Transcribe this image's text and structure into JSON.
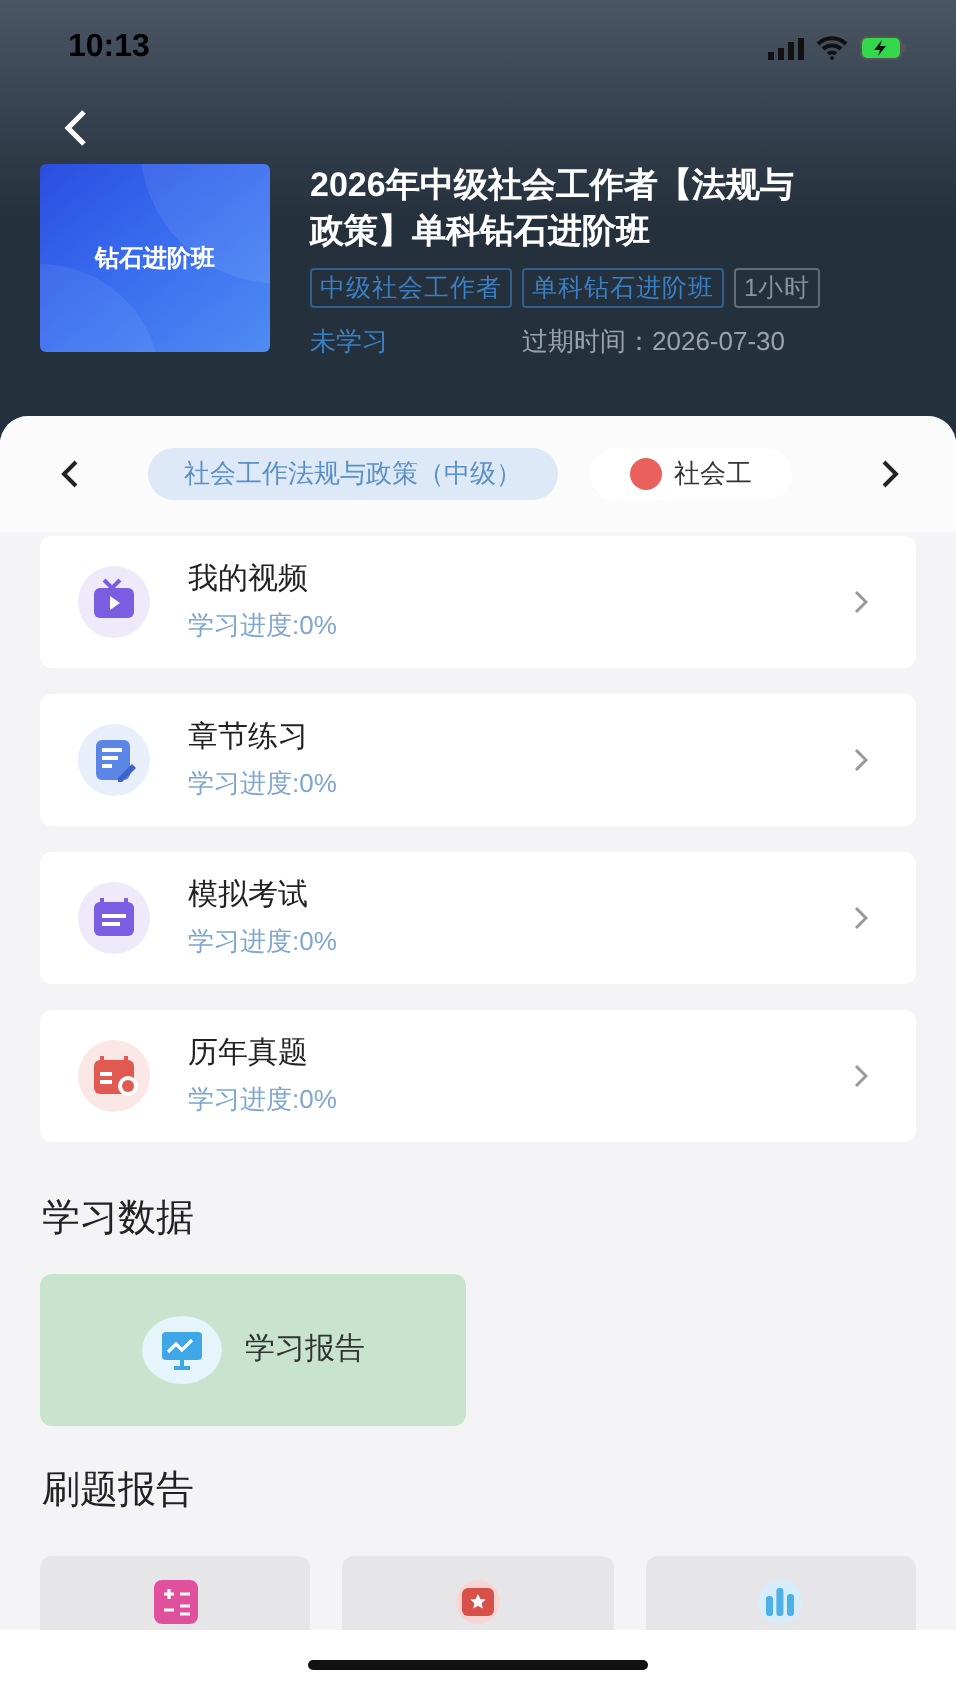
{
  "status_bar": {
    "time": "10:13"
  },
  "course": {
    "cover_label": "钻石进阶班",
    "title": "2026年中级社会工作者【法规与政策】单科钻石进阶班",
    "tags": [
      {
        "label": "中级社会工作者",
        "color": "#3b7fc4"
      },
      {
        "label": "单科钻石进阶班",
        "color": "#3b7fc4"
      },
      {
        "label": "1小时",
        "color": "#8a94a0"
      }
    ],
    "status": "未学习",
    "expiry": "过期时间：2026-07-30"
  },
  "subject_tabs": [
    {
      "label": "社会工作法规与政策（中级）",
      "selected": true,
      "kind": "plain"
    },
    {
      "label": "社会工",
      "selected": false,
      "kind": "badge"
    }
  ],
  "modules": [
    {
      "title": "我的视频",
      "progress": "学习进度:0%",
      "kind": "video"
    },
    {
      "title": "章节练习",
      "progress": "学习进度:0%",
      "kind": "practice"
    },
    {
      "title": "模拟考试",
      "progress": "学习进度:0%",
      "kind": "exam"
    },
    {
      "title": "历年真题",
      "progress": "学习进度:0%",
      "kind": "past"
    }
  ],
  "study_data": {
    "heading": "学习数据",
    "report": "学习报告"
  },
  "practice_report": {
    "heading": "刷题报告",
    "tiles": [
      {
        "kind": "pink"
      },
      {
        "kind": "red"
      },
      {
        "kind": "blue"
      }
    ]
  }
}
